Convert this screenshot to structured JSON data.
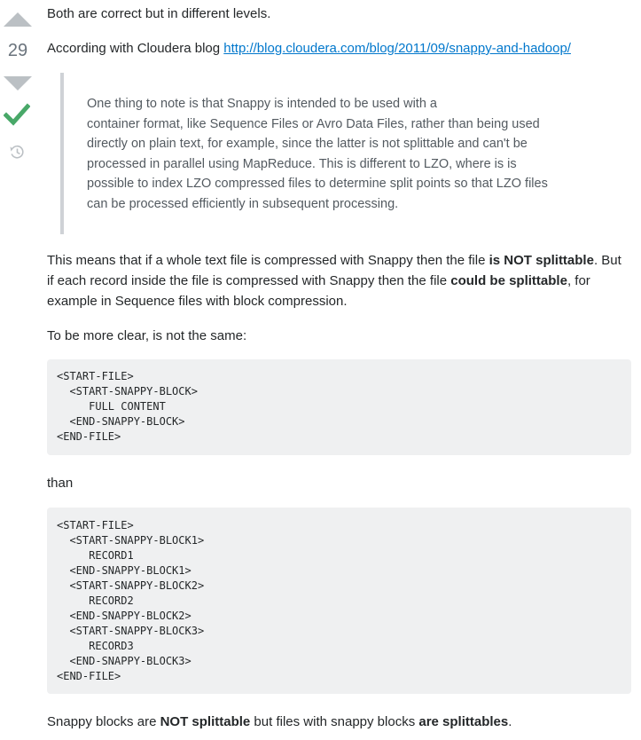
{
  "vote": {
    "count": "29"
  },
  "answer": {
    "intro": "Both are correct but in different levels.",
    "according_prefix": "According with Cloudera blog ",
    "link_text": "http://blog.cloudera.com/blog/2011/09/snappy-and-hadoop/",
    "quote_lines": [
      "One thing to note is that Snappy is intended to be used with a",
      "container format, like Sequence Files or Avro Data Files, rather than being used",
      "directly on plain text, for example, since the latter is not splittable and can't be",
      "processed in parallel using MapReduce. This is different to LZO, where is is",
      "possible to index LZO compressed files to determine split points so that LZO files",
      "can be processed efficiently in subsequent processing."
    ],
    "para1": {
      "a": "This means that if a whole text file is compressed with Snappy then the file ",
      "b": "is NOT splittable",
      "c": ". But",
      "d": "if each record inside the file is compressed with Snappy then the file ",
      "e": "could be splittable",
      "f": ", for",
      "g": "example in Sequence files with block compression."
    },
    "para2": "To be more clear, is not the same:",
    "code1": [
      "<START-FILE>",
      "  <START-SNAPPY-BLOCK>",
      "     FULL CONTENT",
      "  <END-SNAPPY-BLOCK>",
      "<END-FILE>"
    ],
    "than": "than",
    "code2": [
      "<START-FILE>",
      "  <START-SNAPPY-BLOCK1>",
      "     RECORD1",
      "  <END-SNAPPY-BLOCK1>",
      "  <START-SNAPPY-BLOCK2>",
      "     RECORD2",
      "  <END-SNAPPY-BLOCK2>",
      "  <START-SNAPPY-BLOCK3>",
      "     RECORD3",
      "  <END-SNAPPY-BLOCK3>",
      "<END-FILE>"
    ],
    "final": {
      "a": "Snappy blocks are ",
      "b": "NOT splittable",
      "c": " but files with snappy blocks ",
      "d": "are splittables",
      "e": "."
    }
  }
}
